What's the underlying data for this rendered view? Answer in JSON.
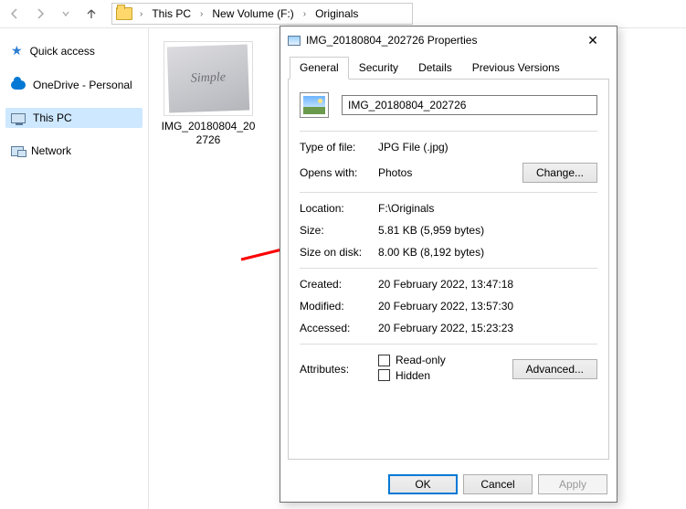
{
  "breadcrumb": {
    "seg1": "This PC",
    "seg2": "New Volume (F:)",
    "seg3": "Originals"
  },
  "sidebar": {
    "quick": "Quick access",
    "onedrive": "OneDrive - Personal",
    "thispc": "This PC",
    "network": "Network"
  },
  "file": {
    "name_line1": "IMG_20180804_20",
    "name_line2": "2726",
    "thumb_text": "Simple"
  },
  "dialog": {
    "title": "IMG_20180804_202726 Properties",
    "tabs": {
      "general": "General",
      "security": "Security",
      "details": "Details",
      "versions": "Previous Versions"
    },
    "filename": "IMG_20180804_202726",
    "labels": {
      "type": "Type of file:",
      "opens": "Opens with:",
      "location": "Location:",
      "size": "Size:",
      "sizeondisk": "Size on disk:",
      "created": "Created:",
      "modified": "Modified:",
      "accessed": "Accessed:",
      "attributes": "Attributes:"
    },
    "values": {
      "type": "JPG File (.jpg)",
      "opens": "Photos",
      "location": "F:\\Originals",
      "size": "5.81 KB (5,959 bytes)",
      "sizeondisk": "8.00 KB (8,192 bytes)",
      "created": "20 February 2022, 13:47:18",
      "modified": "20 February 2022, 13:57:30",
      "accessed": "20 February 2022, 15:23:23"
    },
    "checkboxes": {
      "readonly": "Read-only",
      "hidden": "Hidden"
    },
    "buttons": {
      "change": "Change...",
      "advanced": "Advanced...",
      "ok": "OK",
      "cancel": "Cancel",
      "apply": "Apply"
    }
  }
}
